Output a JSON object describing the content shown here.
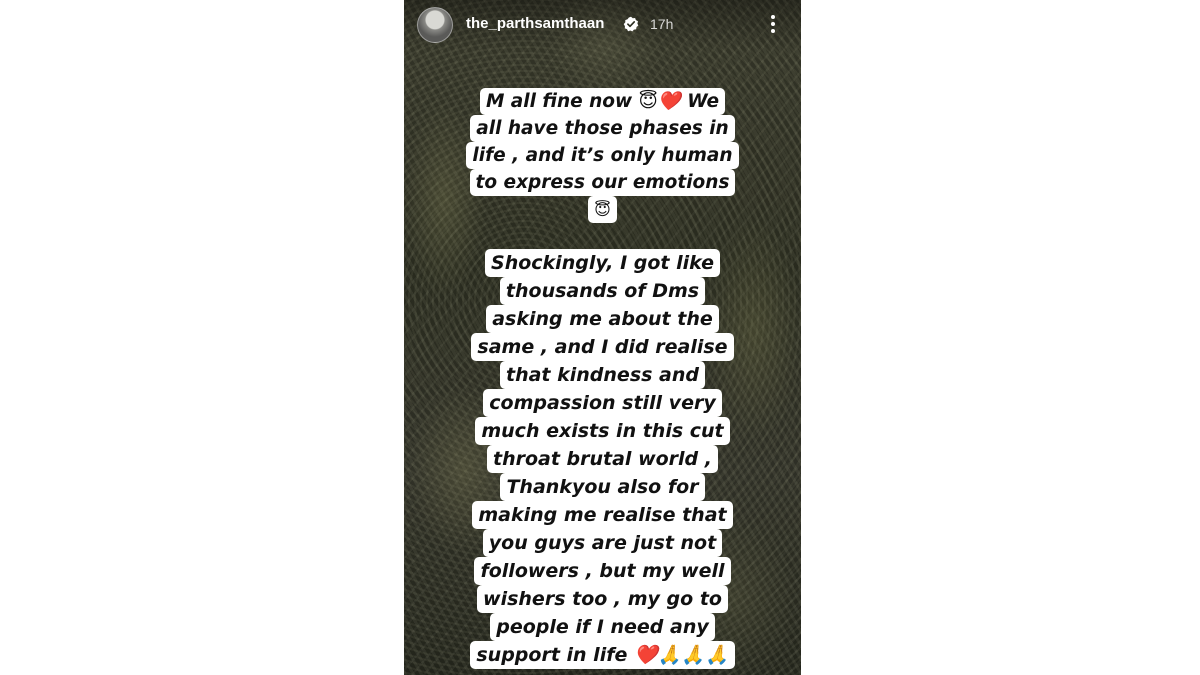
{
  "story": {
    "username": "the_parthsamthaan",
    "time": "17h",
    "captions": [
      {
        "lines": [
          "M all fine now 😇❤️ We",
          "all have those phases in",
          "life , and it’s only human",
          "to express our emotions",
          "😇"
        ]
      },
      {
        "lines": [
          "Shockingly, I got like",
          "thousands of Dms",
          "asking me about the",
          "same , and I did realise",
          "that kindness and",
          "compassion still very",
          "much exists in this cut",
          "throat brutal world ,",
          "Thankyou also for",
          "making me realise that",
          "you guys are just not",
          "followers , but my well",
          "wishers too , my go to",
          "people if I need any",
          "support in life ❤️🙏🙏🙏"
        ]
      }
    ]
  },
  "icons": {
    "verified": "verified-badge-icon",
    "more": "more-options-icon"
  },
  "colors": {
    "verified_badge": "#ffffff",
    "caption_background": "#ffffff",
    "caption_text": "#111111"
  }
}
